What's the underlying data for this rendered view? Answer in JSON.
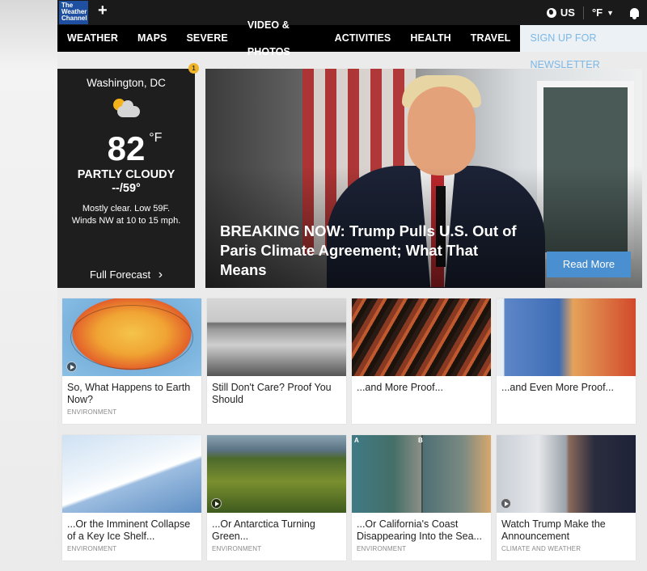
{
  "brand": {
    "logo_text": "The Weather Channel"
  },
  "topbar": {
    "plus": "+",
    "region": "US",
    "units": "°F"
  },
  "nav": {
    "items": [
      "WEATHER",
      "MAPS",
      "SEVERE",
      "VIDEO & PHOTOS",
      "ACTIVITIES",
      "HEALTH",
      "TRAVEL"
    ],
    "newsletter": "SIGN UP FOR NEWSLETTER"
  },
  "weather": {
    "badge": "1",
    "city": "Washington, DC",
    "temp": "82",
    "unit": "°F",
    "condition": "PARTLY CLOUDY",
    "hilo": "--/59°",
    "description_line1": "Mostly clear. Low 59F.",
    "description_line2": "Winds NW at 10 to 15 mph.",
    "forecast_link": "Full Forecast",
    "forecast_chevron": "›"
  },
  "hero": {
    "headline": "BREAKING NOW: Trump Pulls U.S. Out of Paris Climate Agreement; What That Means",
    "button": "Read More"
  },
  "cards": [
    {
      "title": "So, What Happens to Earth Now?",
      "category": "ENVIRONMENT",
      "icon": "play-icon"
    },
    {
      "title": "Still Don't Care? Proof You Should",
      "category": "",
      "icon": ""
    },
    {
      "title": "...and More Proof...",
      "category": "",
      "icon": ""
    },
    {
      "title": "...and Even More Proof...",
      "category": "",
      "icon": ""
    },
    {
      "title": "...Or the Imminent Collapse of a Key Ice Shelf...",
      "category": "ENVIRONMENT",
      "icon": ""
    },
    {
      "title": "...Or Antarctica Turning Green...",
      "category": "ENVIRONMENT",
      "icon": "play-icon"
    },
    {
      "title": "...Or California's Coast Disappearing Into the Sea...",
      "category": "ENVIRONMENT",
      "icon": "",
      "labels": [
        "A",
        "B"
      ]
    },
    {
      "title": "Watch Trump Make the Announcement",
      "category": "CLIMATE AND WEATHER",
      "icon": "play-icon"
    }
  ]
}
